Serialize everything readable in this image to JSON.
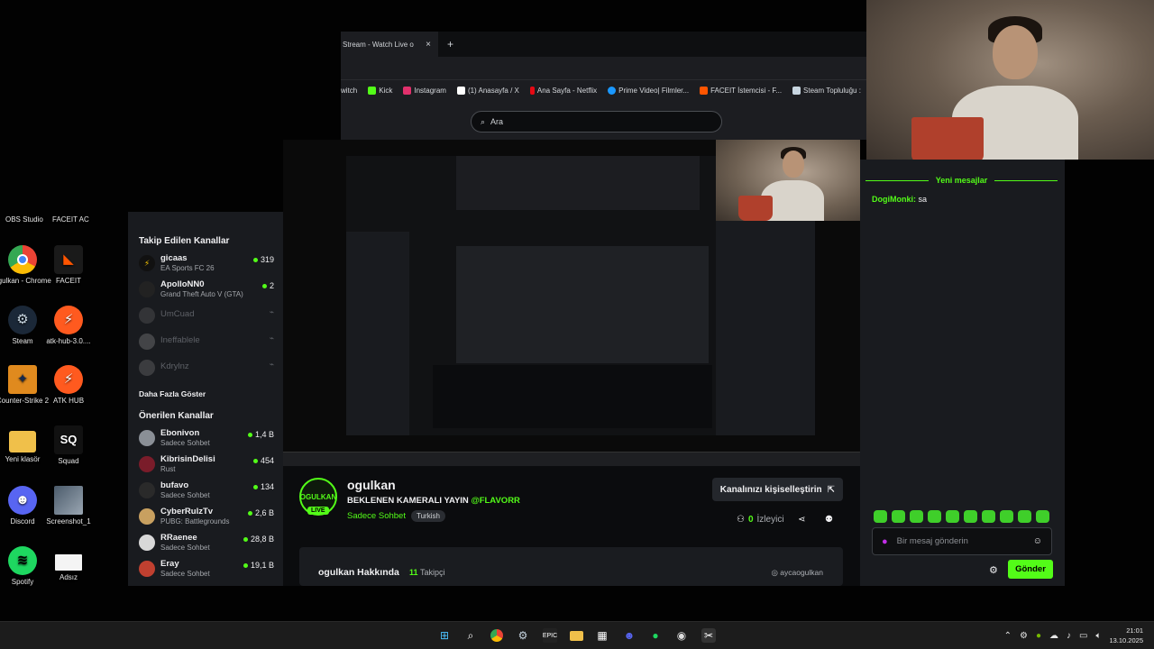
{
  "desktop": {
    "top_labels": [
      "OBS Studio",
      "FACEIT AC"
    ],
    "icons": [
      {
        "label": "ogulkan - Chrome",
        "icon": "chrome-icon",
        "color": "#ffffff"
      },
      {
        "label": "FACEIT",
        "icon": "faceit-icon",
        "color": "#ff5500"
      },
      {
        "label": "Steam",
        "icon": "steam-icon",
        "color": "#1b2838"
      },
      {
        "label": "atk-hub-3.0....",
        "icon": "atk-hub-icon",
        "color": "#ff5a1f"
      },
      {
        "label": "Counter-Strike 2",
        "icon": "counter-strike-icon",
        "color": "#e08a1e"
      },
      {
        "label": "ATK HUB",
        "icon": "atk-hub-icon",
        "color": "#ff5a1f"
      },
      {
        "label": "Yeni klasör",
        "icon": "folder-icon",
        "color": "#f0c04a"
      },
      {
        "label": "Squad",
        "icon": "squad-icon",
        "color": "#222222"
      },
      {
        "label": "Discord",
        "icon": "discord-icon",
        "color": "#5865f2"
      },
      {
        "label": "Screenshot_1",
        "icon": "image-icon",
        "color": "#6a7a8a"
      },
      {
        "label": "Spotify",
        "icon": "spotify-icon",
        "color": "#1ed760"
      },
      {
        "label": "Adsız",
        "icon": "file-icon",
        "color": "#f4f4f4"
      }
    ]
  },
  "browser": {
    "tab_title": "Stream - Watch Live o",
    "new_tab": "+",
    "close_tab": "×",
    "bookmarks": [
      {
        "label": "witch",
        "color": "#9146ff"
      },
      {
        "label": "Kick",
        "color": "#53fc18"
      },
      {
        "label": "Instagram",
        "color": "#e1306c"
      },
      {
        "label": "(1) Anasayfa / X",
        "color": "#ffffff"
      },
      {
        "label": "Ana Sayfa - Netflix",
        "color": "#e50914"
      },
      {
        "label": "Prime Video| Filmler...",
        "color": "#1a98ff"
      },
      {
        "label": "FACEIT İstemcisi - F...",
        "color": "#ff5500"
      },
      {
        "label": "Steam Topluluğu :",
        "color": "#c7d5e0"
      }
    ],
    "search_placeholder": "Ara"
  },
  "sidebar": {
    "followed_title": "Takip Edilen Kanallar",
    "followed": [
      {
        "name": "gicaas",
        "sub": "EA Sports FC 26",
        "count": "319",
        "live": true
      },
      {
        "name": "ApolloNN0",
        "sub": "Grand Theft Auto V (GTA)",
        "count": "2",
        "live": true
      },
      {
        "name": "UmCuad",
        "sub": "",
        "count": "",
        "live": false
      },
      {
        "name": "Ineffablele",
        "sub": "",
        "count": "",
        "live": false
      },
      {
        "name": "Kdrylnz",
        "sub": "",
        "count": "",
        "live": false
      }
    ],
    "show_more": "Daha Fazla Göster",
    "recommended_title": "Önerilen Kanallar",
    "recommended": [
      {
        "name": "Ebonivon",
        "sub": "Sadece Sohbet",
        "count": "1,4 B"
      },
      {
        "name": "KibrisinDelisi",
        "sub": "Rust",
        "count": "454"
      },
      {
        "name": "bufavo",
        "sub": "Sadece Sohbet",
        "count": "134"
      },
      {
        "name": "CyberRulzTv",
        "sub": "PUBG: Battlegrounds",
        "count": "2,6 B"
      },
      {
        "name": "RRaenee",
        "sub": "Sadece Sohbet",
        "count": "28,8 B"
      },
      {
        "name": "Eray",
        "sub": "Sadece Sohbet",
        "count": "19,1 B"
      }
    ]
  },
  "stream": {
    "avatar_text": "OGULKAN",
    "live_badge": "LIVE",
    "streamer": "ogulkan",
    "title": "BEKLENEN KAMERALI YAYIN ",
    "title_mention": "@FLAVORR",
    "category": "Sadece Sohbet",
    "language": "Turkish",
    "customize": "Kanalınızı kişiselleştirin",
    "viewers": "0",
    "viewers_label": "İzleyici",
    "about_title": "ogulkan Hakkında",
    "followers": "11",
    "followers_label": "Takipçi",
    "instagram": "aycaogulkan"
  },
  "chat": {
    "new_messages": "Yeni mesajlar",
    "message_user": "DogiMonki:",
    "message_text": "sa",
    "input_placeholder": "Bir mesaj gönderin",
    "send": "Gönder"
  },
  "taskbar": {
    "time": "21:01",
    "date": "13.10.2025"
  },
  "colors": {
    "accent": "#53fc18",
    "panel": "#191b1f",
    "background": "#0b0c0e"
  }
}
